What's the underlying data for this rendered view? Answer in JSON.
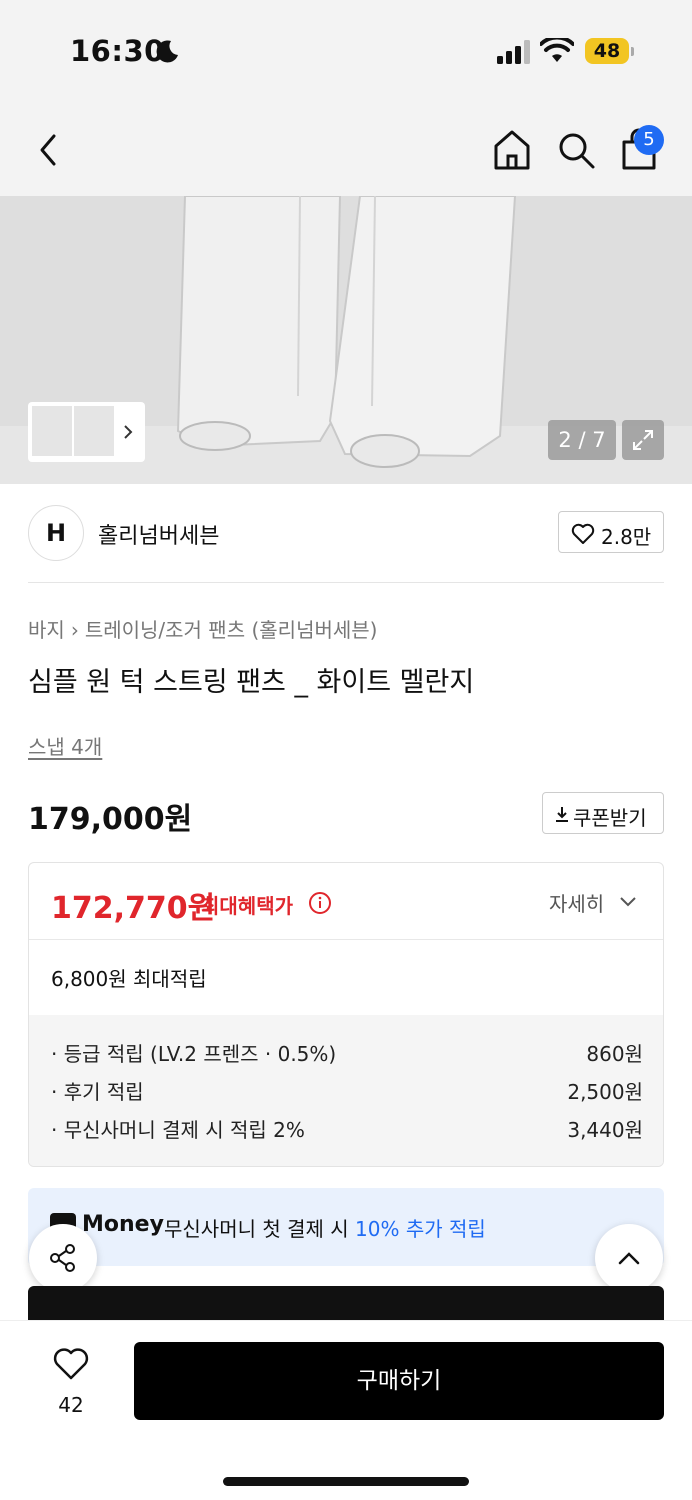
{
  "status_bar": {
    "time": "16:30",
    "battery": "48"
  },
  "nav": {
    "cart_count": "5"
  },
  "gallery": {
    "counter": "2 / 7"
  },
  "brand": {
    "logo_text": "H",
    "name": "홀리넘버세븐",
    "likes": "2.8만"
  },
  "product": {
    "breadcrumb": [
      "바지",
      "트레이닝/조거 팬츠 (홀리넘버세븐)"
    ],
    "title": "심플 원 턱 스트링 팬츠 _ 화이트 멜란지",
    "snap": "스냅 4개",
    "price": "179,000원",
    "coupon_label": "쿠폰받기"
  },
  "benefit": {
    "max_price": "172,770원",
    "max_label": "최대혜택가",
    "detail_label": "자세히",
    "points_total": "6,800원 최대적립",
    "rows": [
      {
        "label": "· 등급 적립 (LV.2 프렌즈 · 0.5%)",
        "value": "860원"
      },
      {
        "label": "· 후기 적립",
        "value": "2,500원"
      },
      {
        "label": "· 무신사머니 결제 시 적립 2%",
        "value": "3,440원"
      }
    ]
  },
  "money_banner": {
    "brand": "Money",
    "text": "무신사머니 첫 결제 시 ",
    "highlight": "10% 추가 적립"
  },
  "bottom_bar": {
    "like_count": "42",
    "buy_label": "구매하기"
  },
  "colors": {
    "accent_red": "#e0262c",
    "accent_blue": "#1f6bf3",
    "battery": "#f2c522"
  }
}
